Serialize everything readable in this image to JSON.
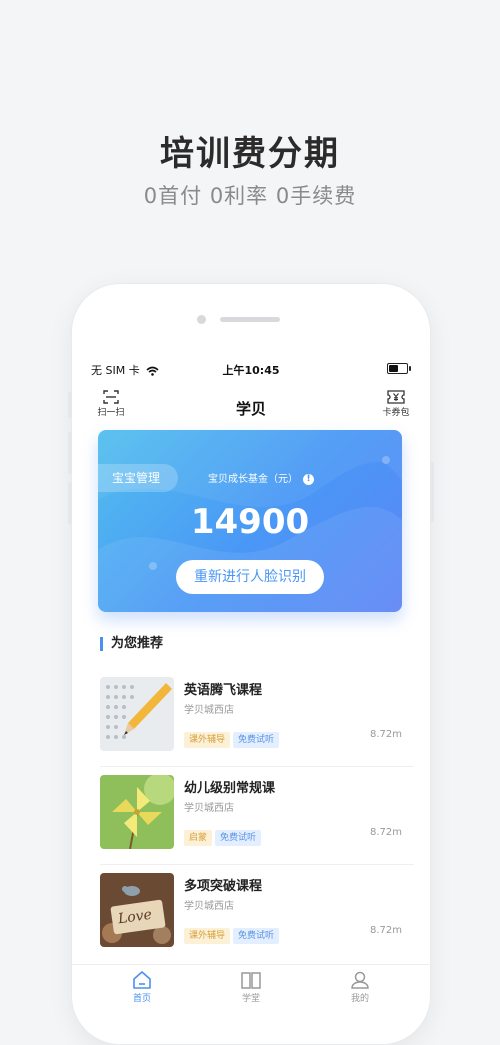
{
  "promo": {
    "title": "培训费分期",
    "subtitle": "0首付 0利率 0手续费"
  },
  "status_bar": {
    "carrier": "无 SIM 卡",
    "time": "上午10:45"
  },
  "nav": {
    "scan_label": "扫一扫",
    "title": "学贝",
    "wallet_label": "卡券包"
  },
  "card": {
    "baby_manage": "宝宝管理",
    "fund_label": "宝贝成长基金（元）",
    "info_symbol": "!",
    "amount": "14900",
    "face_button": "重新进行人脸识别"
  },
  "recommend": {
    "title": "为您推荐",
    "courses": [
      {
        "name": "英语腾飞课程",
        "store": "学贝城西店",
        "tags": [
          "课外辅导",
          "免费试听"
        ],
        "distance": "8.72m",
        "thumb": "pencil-exam-image"
      },
      {
        "name": "幼儿级别常规课",
        "store": "学贝城西店",
        "tags": [
          "启蒙",
          "免费试听"
        ],
        "distance": "8.72m",
        "thumb": "pinwheel-image"
      },
      {
        "name": "多项突破课程",
        "store": "学贝城西店",
        "tags": [
          "课外辅导",
          "免费试听"
        ],
        "distance": "8.72m",
        "thumb": "love-sign-image"
      }
    ]
  },
  "tabbar": {
    "items": [
      {
        "label": "首页",
        "icon": "home-icon",
        "active": true
      },
      {
        "label": "学堂",
        "icon": "book-icon",
        "active": false
      },
      {
        "label": "我的",
        "icon": "user-icon",
        "active": false
      }
    ]
  },
  "colors": {
    "accent": "#4a90f0",
    "card_gradient_start": "#52bfee",
    "card_gradient_end": "#5d84f6",
    "tag_yellow_bg": "#fcf1d6",
    "tag_blue_bg": "#e3efff"
  }
}
